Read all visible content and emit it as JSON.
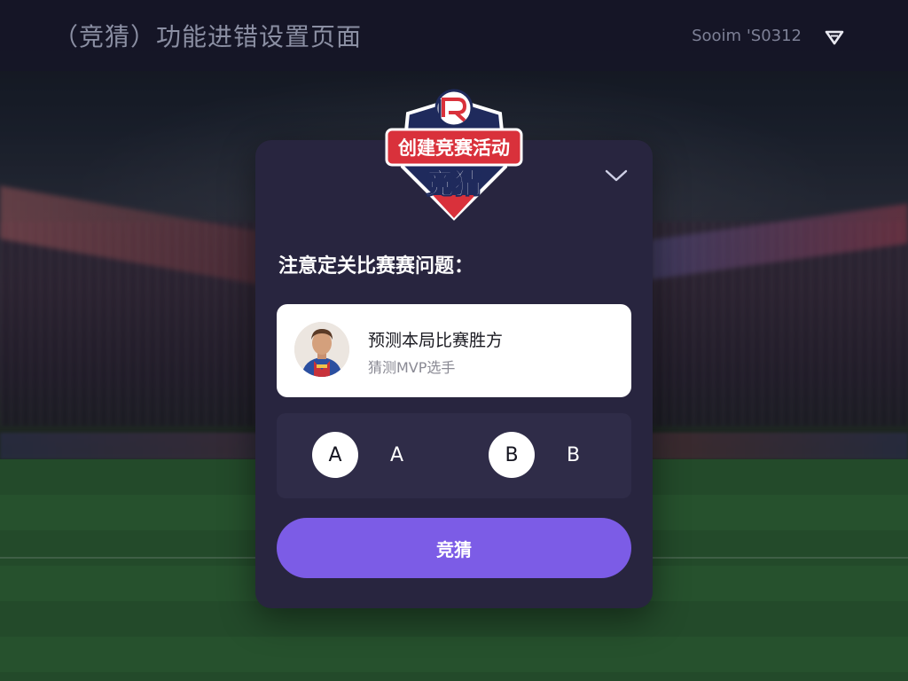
{
  "header": {
    "title": "（竞猜）功能进错设置页面",
    "status_text": "Sooim  'S0312",
    "signal_icon": "signal-triangle-icon"
  },
  "modal": {
    "badge": {
      "line1": "创建竞赛活动",
      "line2": "竞猜"
    },
    "collapse_icon": "chevron-down-icon",
    "prompt": "注意定关比赛赛问题：",
    "question": {
      "title": "预测本局比赛胜方",
      "subtitle": "猜测MVP选手"
    },
    "options": [
      {
        "key": "A",
        "label": "A"
      },
      {
        "key": "B",
        "label": "B"
      }
    ],
    "submit_label": "竞猜"
  },
  "colors": {
    "modal_bg": "#28253f",
    "accent": "#7c5ce6",
    "badge_red": "#d9313b",
    "badge_navy": "#1f2a5c"
  }
}
